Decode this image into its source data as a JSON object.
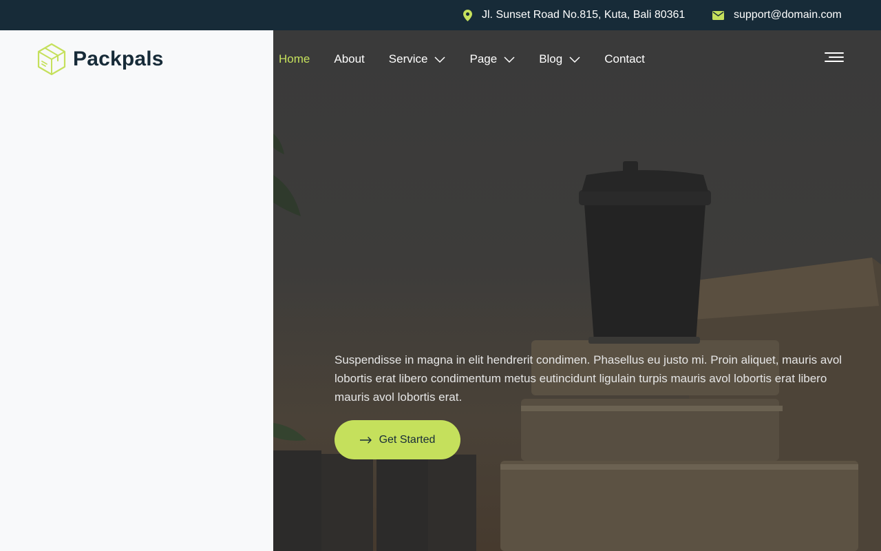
{
  "topbar": {
    "address": "Jl. Sunset Road No.815, Kuta, Bali 80361",
    "email": "support@domain.com",
    "address_icon": "map-pin-icon",
    "email_icon": "envelope-icon"
  },
  "brand": {
    "name": "Packpals",
    "logo_icon": "box-logo-icon"
  },
  "nav": {
    "home": "Home",
    "about": "About",
    "service": "Service",
    "page": "Page",
    "blog": "Blog",
    "contact": "Contact",
    "menu_icon": "hamburger-icon"
  },
  "hero": {
    "description": "Suspendisse in magna in elit hendrerit condimen. Phasellus eu justo mi. Proin aliquet, mauris avol lobortis erat libero condimentum metus eutincidunt ligulain turpis mauris avol lobortis erat libero mauris avol lobortis erat.",
    "cta_label": "Get Started",
    "cta_icon": "arrow-right-icon"
  },
  "colors": {
    "accent": "#c5e05c",
    "dark": "#172b38",
    "panel": "#f8f9fa"
  }
}
